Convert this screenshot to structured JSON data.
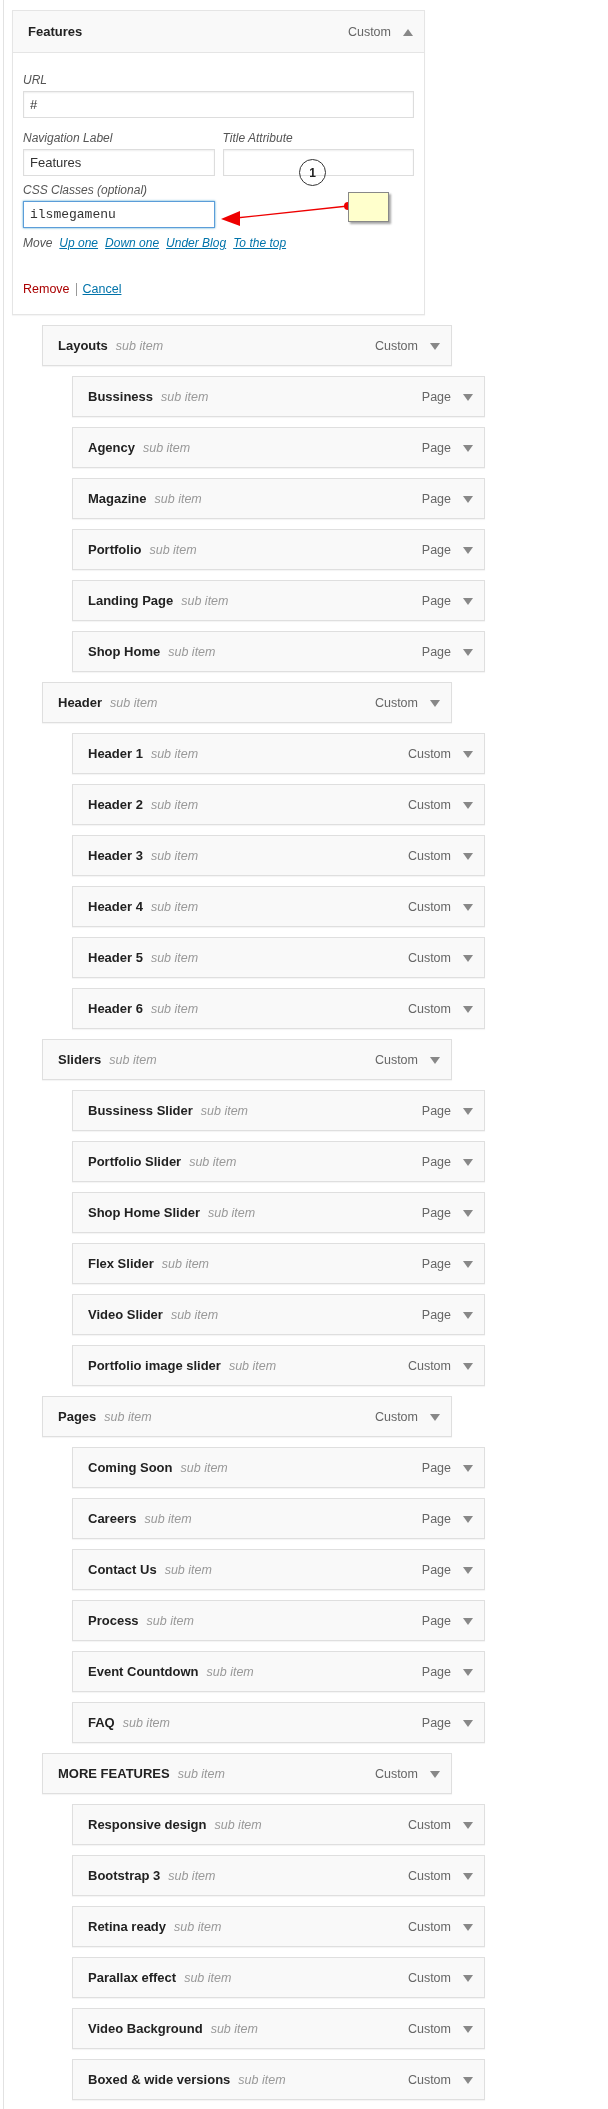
{
  "open_item": {
    "title": "Features",
    "type": "Custom",
    "expanded": true,
    "url": {
      "label": "URL",
      "value": "#"
    },
    "navigation_label": {
      "label": "Navigation Label",
      "value": "Features"
    },
    "title_attribute": {
      "label": "Title Attribute"
    },
    "css_classes": {
      "label": "CSS Classes (optional)",
      "value": "ilsmegamenu"
    },
    "move": {
      "label": "Move",
      "links": [
        "Up one",
        "Down one",
        "Under Blog",
        "To the top"
      ]
    },
    "remove": "Remove",
    "cancel": "Cancel"
  },
  "annotation": {
    "number": "1"
  },
  "items": [
    {
      "title": "Layouts",
      "note": "sub item",
      "type": "Custom",
      "expanded": false,
      "children": [
        {
          "title": "Bussiness",
          "note": "sub item",
          "type": "Page",
          "expanded": false
        },
        {
          "title": "Agency",
          "note": "sub item",
          "type": "Page",
          "expanded": false
        },
        {
          "title": "Magazine",
          "note": "sub item",
          "type": "Page",
          "expanded": false
        },
        {
          "title": "Portfolio",
          "note": "sub item",
          "type": "Page",
          "expanded": false
        },
        {
          "title": "Landing Page",
          "note": "sub item",
          "type": "Page",
          "expanded": false
        },
        {
          "title": "Shop Home",
          "note": "sub item",
          "type": "Page",
          "expanded": false
        }
      ]
    },
    {
      "title": "Header",
      "note": "sub item",
      "type": "Custom",
      "expanded": false,
      "children": [
        {
          "title": "Header 1",
          "note": "sub item",
          "type": "Custom",
          "expanded": false
        },
        {
          "title": "Header 2",
          "note": "sub item",
          "type": "Custom",
          "expanded": false
        },
        {
          "title": "Header 3",
          "note": "sub item",
          "type": "Custom",
          "expanded": false
        },
        {
          "title": "Header 4",
          "note": "sub item",
          "type": "Custom",
          "expanded": false
        },
        {
          "title": "Header 5",
          "note": "sub item",
          "type": "Custom",
          "expanded": false
        },
        {
          "title": "Header 6",
          "note": "sub item",
          "type": "Custom",
          "expanded": false
        }
      ]
    },
    {
      "title": "Sliders",
      "note": "sub item",
      "type": "Custom",
      "expanded": false,
      "children": [
        {
          "title": "Bussiness Slider",
          "note": "sub item",
          "type": "Page",
          "expanded": false
        },
        {
          "title": "Portfolio Slider",
          "note": "sub item",
          "type": "Page",
          "expanded": false
        },
        {
          "title": "Shop Home Slider",
          "note": "sub item",
          "type": "Page",
          "expanded": false
        },
        {
          "title": "Flex Slider",
          "note": "sub item",
          "type": "Page",
          "expanded": false
        },
        {
          "title": "Video Slider",
          "note": "sub item",
          "type": "Page",
          "expanded": false
        },
        {
          "title": "Portfolio image slider",
          "note": "sub item",
          "type": "Custom",
          "expanded": false
        }
      ]
    },
    {
      "title": "Pages",
      "note": "sub item",
      "type": "Custom",
      "expanded": false,
      "children": [
        {
          "title": "Coming Soon",
          "note": "sub item",
          "type": "Page",
          "expanded": false
        },
        {
          "title": "Careers",
          "note": "sub item",
          "type": "Page",
          "expanded": false
        },
        {
          "title": "Contact Us",
          "note": "sub item",
          "type": "Page",
          "expanded": false
        },
        {
          "title": "Process",
          "note": "sub item",
          "type": "Page",
          "expanded": false
        },
        {
          "title": "Event Countdown",
          "note": "sub item",
          "type": "Page",
          "expanded": false
        },
        {
          "title": "FAQ",
          "note": "sub item",
          "type": "Page",
          "expanded": false
        }
      ]
    },
    {
      "title": "MORE FEATURES",
      "note": "sub item",
      "type": "Custom",
      "expanded": false,
      "children": [
        {
          "title": "Responsive design",
          "note": "sub item",
          "type": "Custom",
          "expanded": false
        },
        {
          "title": "Bootstrap 3",
          "note": "sub item",
          "type": "Custom",
          "expanded": false
        },
        {
          "title": "Retina ready",
          "note": "sub item",
          "type": "Custom",
          "expanded": false
        },
        {
          "title": "Parallax effect",
          "note": "sub item",
          "type": "Custom",
          "expanded": false
        },
        {
          "title": "Video Background",
          "note": "sub item",
          "type": "Custom",
          "expanded": false
        },
        {
          "title": "Boxed & wide versions",
          "note": "sub item",
          "type": "Custom",
          "expanded": false
        }
      ]
    }
  ]
}
